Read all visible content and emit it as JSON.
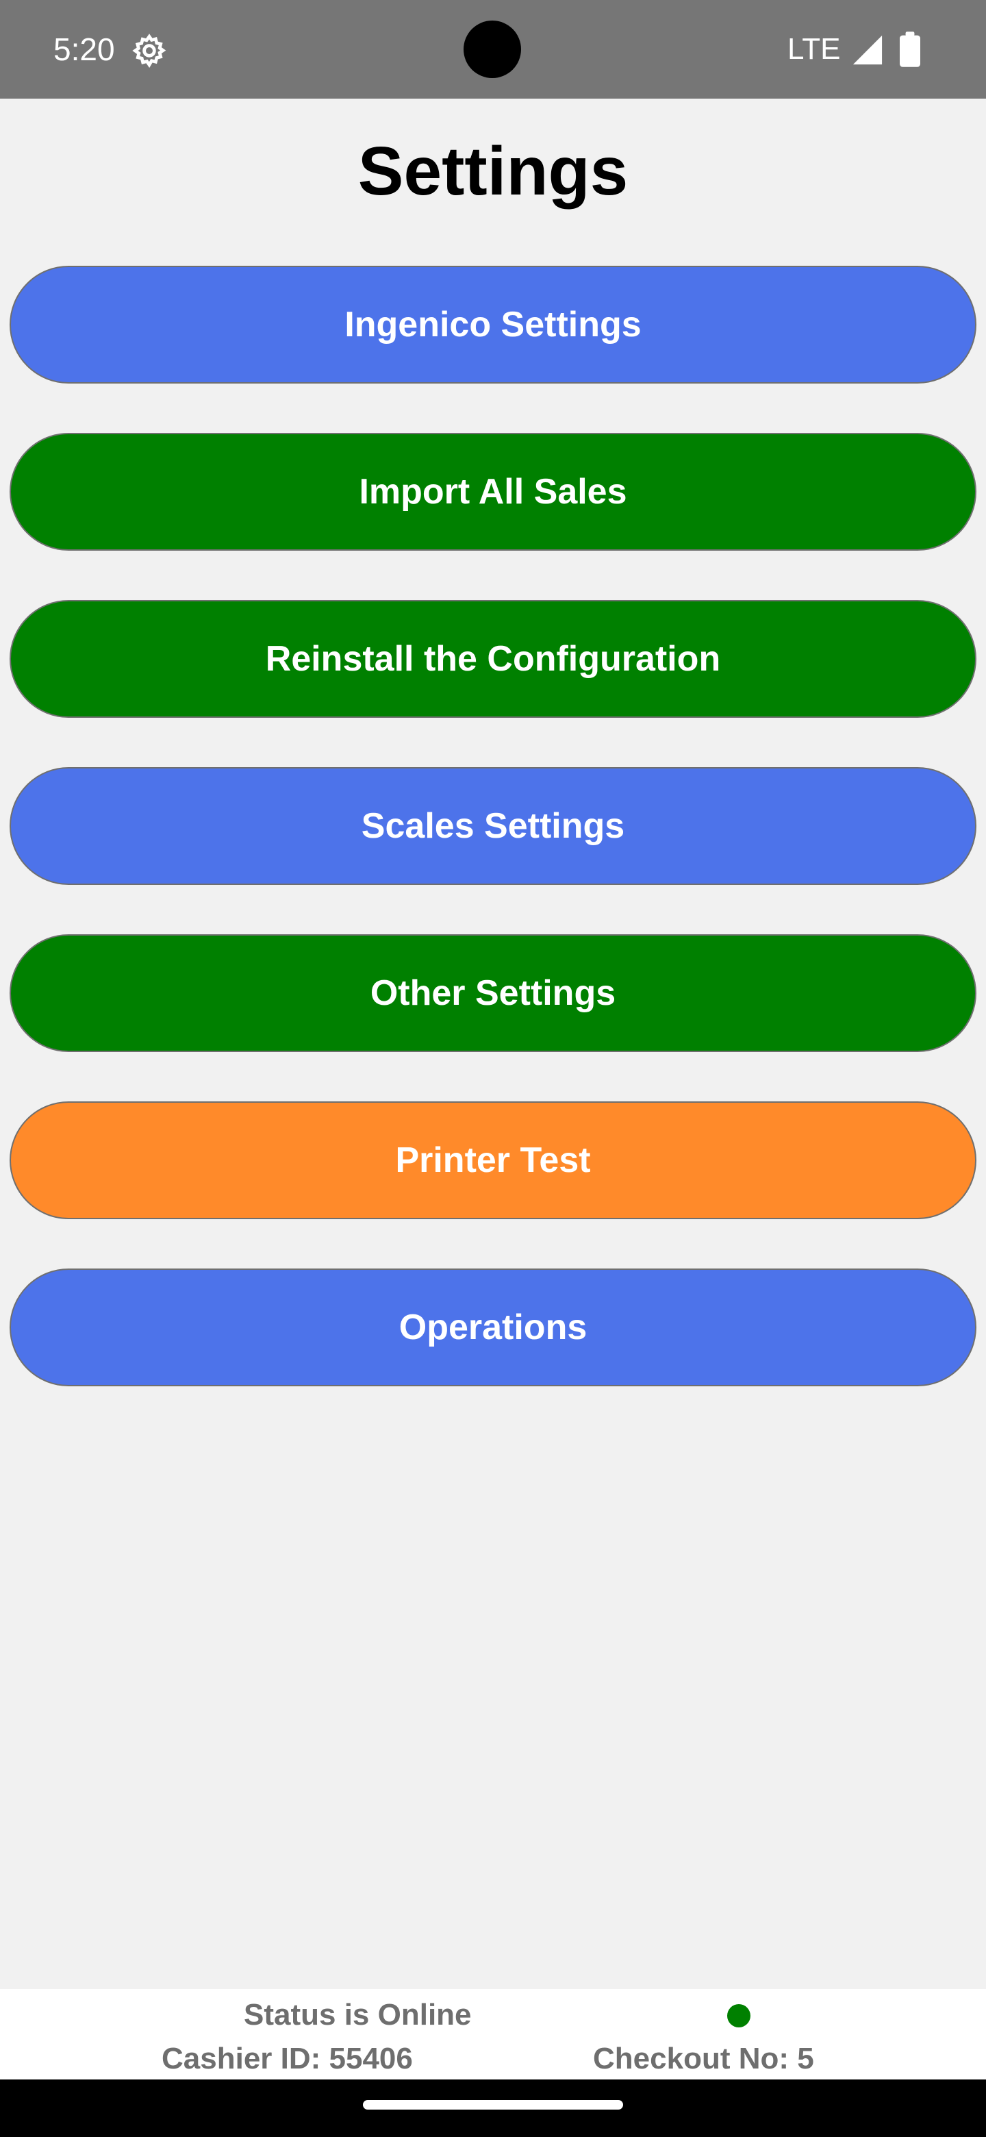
{
  "status_bar": {
    "time": "5:20",
    "network": "LTE",
    "icons": [
      "gear-icon",
      "signal-icon",
      "battery-icon"
    ]
  },
  "title": "Settings",
  "buttons": [
    {
      "label": "Ingenico Settings",
      "color": "#4d73ea"
    },
    {
      "label": "Import All Sales",
      "color": "#008000"
    },
    {
      "label": "Reinstall the Configuration",
      "color": "#008000"
    },
    {
      "label": "Scales Settings",
      "color": "#4d73ea"
    },
    {
      "label": "Other Settings",
      "color": "#008000"
    },
    {
      "label": "Printer Test",
      "color": "#ff8a2a"
    },
    {
      "label": "Operations",
      "color": "#4d73ea"
    }
  ],
  "footer": {
    "status": "Status is Online",
    "status_color": "#008000",
    "cashier": "Cashier ID: 55406",
    "checkout": "Checkout No: 5"
  }
}
